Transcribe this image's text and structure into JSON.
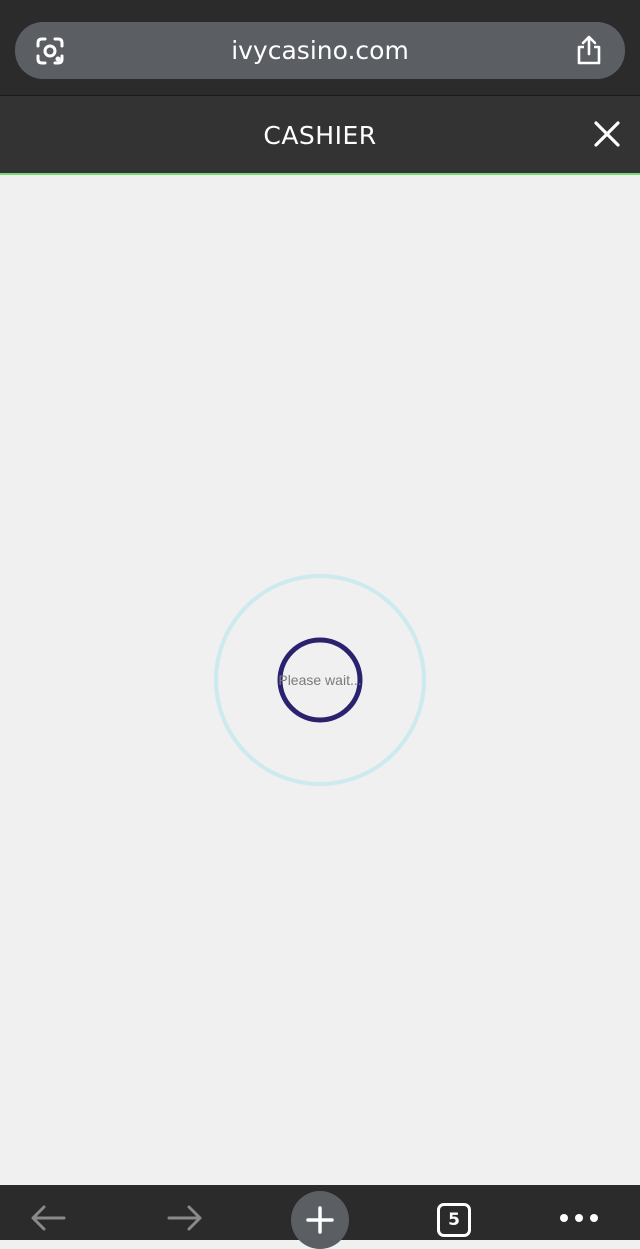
{
  "browser": {
    "url": "ivycasino.com",
    "open_tab_count": "5",
    "icons": {
      "lens": "google-lens-icon",
      "share": "share-icon",
      "back": "back-arrow-icon",
      "forward": "forward-arrow-icon",
      "new_tab": "plus-icon",
      "tabs": "tab-switcher-icon",
      "menu": "more-horizontal-icon"
    }
  },
  "modal": {
    "title": "CASHIER",
    "close_icon": "close-icon"
  },
  "loader": {
    "text": "Please wait..."
  },
  "colors": {
    "browser_chrome": "#2b2b2b",
    "url_bar": "#5b5e63",
    "modal_header": "#333333",
    "header_accent": "#78d97a",
    "content_background": "#f0f0f0",
    "outer_ring": "#cdeaee",
    "inner_ring": "#2a226f",
    "loading_text": "#7a7a7a",
    "disabled_nav": "#8a8a8a"
  }
}
